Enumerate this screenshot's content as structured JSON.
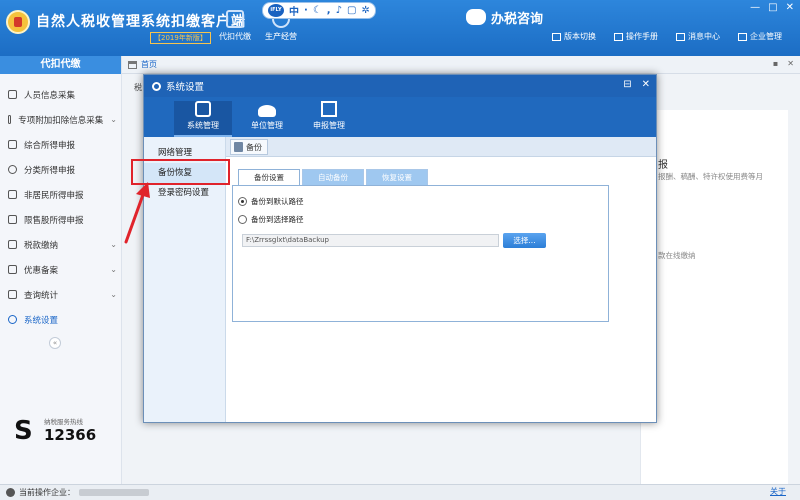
{
  "header": {
    "app_title": "自然人税收管理系统扣缴客户端",
    "version_badge": "【2019年新版】",
    "tools": [
      {
        "label": "代扣代缴",
        "icon": "briefcase-icon"
      },
      {
        "label": "生产经营",
        "icon": "document-icon"
      }
    ],
    "ime": {
      "badge": "iFLY",
      "mode": "中"
    },
    "consult_label": "办税咨询",
    "top_links": [
      {
        "label": "版本切换",
        "icon": "switch-icon"
      },
      {
        "label": "操作手册",
        "icon": "manual-icon"
      },
      {
        "label": "消息中心",
        "icon": "mail-icon"
      },
      {
        "label": "企业管理",
        "icon": "building-icon"
      }
    ],
    "window_controls": [
      "—",
      "□",
      "✕"
    ]
  },
  "sidebar": {
    "title": "代扣代缴",
    "items": [
      {
        "label": "人员信息采集",
        "icon": "person-icon",
        "chevron": ""
      },
      {
        "label": "专项附加扣除信息采集",
        "icon": "grid-icon",
        "chevron": "⌄"
      },
      {
        "label": "综合所得申报",
        "icon": "layers-icon",
        "chevron": ""
      },
      {
        "label": "分类所得申报",
        "icon": "pie-icon",
        "chevron": ""
      },
      {
        "label": "非居民所得申报",
        "icon": "user-icon",
        "chevron": ""
      },
      {
        "label": "限售股所得申报",
        "icon": "bar-icon",
        "chevron": ""
      },
      {
        "label": "税款缴纳",
        "icon": "folder-icon",
        "chevron": "⌄"
      },
      {
        "label": "优惠备案",
        "icon": "folder-icon",
        "chevron": "⌄"
      },
      {
        "label": "查询统计",
        "icon": "search-doc-icon",
        "chevron": "⌄"
      },
      {
        "label": "系统设置",
        "icon": "gear-icon",
        "chevron": ""
      }
    ],
    "collapse_symbol": "«",
    "hotline_label": "纳税服务热线",
    "hotline_number": "12366"
  },
  "main": {
    "breadcrumb": "首页",
    "side_text": "税",
    "bg_text_1": "报",
    "bg_text_2": "报酬、稿酬、特许权使用费等月",
    "bg_text_3": "款在线缴纳"
  },
  "dialog": {
    "title": "系统设置",
    "controls": [
      "⊟",
      "✕"
    ],
    "top_nav": [
      {
        "label": "系统管理",
        "icon": "lock-icon"
      },
      {
        "label": "单位管理",
        "icon": "users-icon"
      },
      {
        "label": "申报管理",
        "icon": "edit-icon"
      }
    ],
    "left_nav": [
      "网络管理",
      "备份恢复",
      "登录密码设置"
    ],
    "toolbar_tab": "备份",
    "sub_tabs": [
      "备份设置",
      "自动备份",
      "恢复设置"
    ],
    "radio_options": [
      "备份到默认路径",
      "备份到选择路径"
    ],
    "path_value": "F:\\Zrrssglxt\\dataBackup",
    "select_button": "选择..."
  },
  "statusbar": {
    "label": "当前操作企业：",
    "about": "关于"
  },
  "annotation": {
    "color": "#e0232b"
  }
}
